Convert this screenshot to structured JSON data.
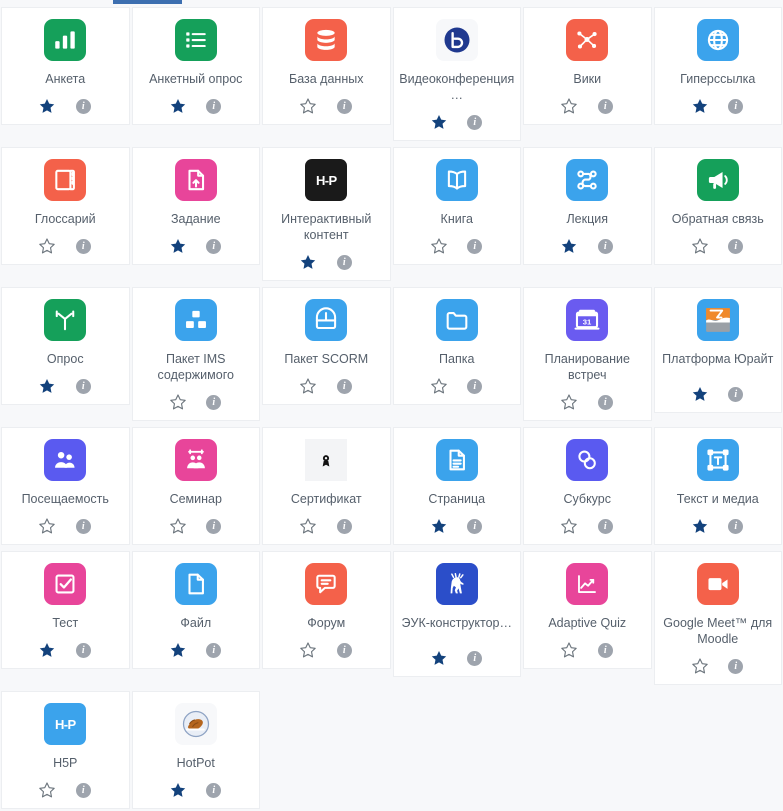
{
  "tab": {
    "active_label": "",
    "accent_color": "#3d6fb0"
  },
  "colors": {
    "star_filled": "#13427c",
    "star_outline": "#6c757d",
    "info_bg": "#9ea4ad",
    "card_bg": "#ffffff",
    "page_bg": "#f7f8fa",
    "label_text": "#555f6b"
  },
  "cards": [
    {
      "label": "Анкета",
      "icon": "bar-chart-icon",
      "icon_bg": "#15a05a",
      "icon_fg": "#ffffff",
      "starred": true,
      "star_icon": "star-filled-icon",
      "info_icon": "info-icon",
      "lines": 1
    },
    {
      "label": "Анкетный опрос",
      "icon": "survey-list-icon",
      "icon_bg": "#15a05a",
      "icon_fg": "#ffffff",
      "starred": true,
      "star_icon": "star-filled-icon",
      "info_icon": "info-icon",
      "lines": 1
    },
    {
      "label": "База данных",
      "icon": "database-icon",
      "icon_bg": "#f4614a",
      "icon_fg": "#ffffff",
      "starred": false,
      "star_icon": "star-outline-icon",
      "info_icon": "info-icon",
      "lines": 1
    },
    {
      "label": "Видеоконференция…",
      "icon": "bigbluebutton-icon",
      "icon_bg": "#f7f8fa",
      "icon_fg": "#20398f",
      "starred": true,
      "star_icon": "star-filled-icon",
      "info_icon": "info-icon",
      "lines": 2
    },
    {
      "label": "Вики",
      "icon": "wiki-network-icon",
      "icon_bg": "#f4614a",
      "icon_fg": "#ffffff",
      "starred": false,
      "star_icon": "star-outline-icon",
      "info_icon": "info-icon",
      "lines": 1
    },
    {
      "label": "Гиперссылка",
      "icon": "globe-link-icon",
      "icon_bg": "#3ba3ec",
      "icon_fg": "#ffffff",
      "starred": true,
      "star_icon": "star-filled-icon",
      "info_icon": "info-icon",
      "lines": 1
    },
    {
      "label": "Глоссарий",
      "icon": "book-glossary-icon",
      "icon_bg": "#f4614a",
      "icon_fg": "#ffffff",
      "starred": false,
      "star_icon": "star-outline-icon",
      "info_icon": "info-icon",
      "lines": 1
    },
    {
      "label": "Задание",
      "icon": "assignment-upload-icon",
      "icon_bg": "#e8459a",
      "icon_fg": "#ffffff",
      "starred": true,
      "star_icon": "star-filled-icon",
      "info_icon": "info-icon",
      "lines": 1
    },
    {
      "label": "Интерактивный контент",
      "icon": "h5p-black-icon",
      "icon_bg": "#1a1a1a",
      "icon_fg": "#ffffff",
      "starred": true,
      "star_icon": "star-filled-icon",
      "info_icon": "info-icon",
      "lines": 2
    },
    {
      "label": "Книга",
      "icon": "book-open-icon",
      "icon_bg": "#3ba3ec",
      "icon_fg": "#ffffff",
      "starred": false,
      "star_icon": "star-outline-icon",
      "info_icon": "info-icon",
      "lines": 1
    },
    {
      "label": "Лекция",
      "icon": "lesson-flow-icon",
      "icon_bg": "#3ba3ec",
      "icon_fg": "#ffffff",
      "starred": true,
      "star_icon": "star-filled-icon",
      "info_icon": "info-icon",
      "lines": 1
    },
    {
      "label": "Обратная связь",
      "icon": "megaphone-icon",
      "icon_bg": "#15a05a",
      "icon_fg": "#ffffff",
      "starred": false,
      "star_icon": "star-outline-icon",
      "info_icon": "info-icon",
      "lines": 1
    },
    {
      "label": "Опрос",
      "icon": "choice-fork-icon",
      "icon_bg": "#15a05a",
      "icon_fg": "#ffffff",
      "starred": true,
      "star_icon": "star-filled-icon",
      "info_icon": "info-icon",
      "lines": 1
    },
    {
      "label": "Пакет IMS содержимого",
      "icon": "ims-package-icon",
      "icon_bg": "#3ba3ec",
      "icon_fg": "#ffffff",
      "starred": false,
      "star_icon": "star-outline-icon",
      "info_icon": "info-icon",
      "lines": 2
    },
    {
      "label": "Пакет SCORM",
      "icon": "scorm-box-icon",
      "icon_bg": "#3ba3ec",
      "icon_fg": "#ffffff",
      "starred": false,
      "star_icon": "star-outline-icon",
      "info_icon": "info-icon",
      "lines": 1
    },
    {
      "label": "Папка",
      "icon": "folder-icon",
      "icon_bg": "#3ba3ec",
      "icon_fg": "#ffffff",
      "starred": false,
      "star_icon": "star-outline-icon",
      "info_icon": "info-icon",
      "lines": 1
    },
    {
      "label": "Планирование встреч",
      "icon": "calendar-31-icon",
      "icon_bg": "#6a5bf0",
      "icon_fg": "#ffffff",
      "starred": false,
      "star_icon": "star-outline-icon",
      "info_icon": "info-icon",
      "lines": 2
    },
    {
      "label": "Платформа Юрайт",
      "icon": "urait-icon",
      "icon_bg": "#3ba3ec",
      "icon_fg": "#f0892a",
      "starred": true,
      "star_icon": "star-filled-icon",
      "info_icon": "info-icon",
      "lines": 2
    },
    {
      "label": "Посещаемость",
      "icon": "attendance-people-icon",
      "icon_bg": "#5a5af0",
      "icon_fg": "#ffffff",
      "starred": false,
      "star_icon": "star-outline-icon",
      "info_icon": "info-icon",
      "lines": 1
    },
    {
      "label": "Семинар",
      "icon": "workshop-icon",
      "icon_bg": "#e8459a",
      "icon_fg": "#ffffff",
      "starred": false,
      "star_icon": "star-outline-icon",
      "info_icon": "info-icon",
      "lines": 1
    },
    {
      "label": "Сертификат",
      "icon": "certificate-icon",
      "icon_bg": "#f3f4f6",
      "icon_fg": "#111111",
      "starred": false,
      "star_icon": "star-outline-icon",
      "info_icon": "info-icon",
      "lines": 1
    },
    {
      "label": "Страница",
      "icon": "page-document-icon",
      "icon_bg": "#3ba3ec",
      "icon_fg": "#ffffff",
      "starred": true,
      "star_icon": "star-filled-icon",
      "info_icon": "info-icon",
      "lines": 1
    },
    {
      "label": "Субкурс",
      "icon": "subcourse-icon",
      "icon_bg": "#5a5af0",
      "icon_fg": "#ffffff",
      "starred": false,
      "star_icon": "star-outline-icon",
      "info_icon": "info-icon",
      "lines": 1
    },
    {
      "label": "Текст и медиа",
      "icon": "text-media-icon",
      "icon_bg": "#3ba3ec",
      "icon_fg": "#ffffff",
      "starred": true,
      "star_icon": "star-filled-icon",
      "info_icon": "info-icon",
      "lines": 1
    },
    {
      "label": "Тест",
      "icon": "quiz-checkbox-icon",
      "icon_bg": "#e8459a",
      "icon_fg": "#ffffff",
      "starred": true,
      "star_icon": "star-filled-icon",
      "info_icon": "info-icon",
      "lines": 1
    },
    {
      "label": "Файл",
      "icon": "file-icon",
      "icon_bg": "#3ba3ec",
      "icon_fg": "#ffffff",
      "starred": true,
      "star_icon": "star-filled-icon",
      "info_icon": "info-icon",
      "lines": 1
    },
    {
      "label": "Форум",
      "icon": "forum-chat-icon",
      "icon_bg": "#f4614a",
      "icon_fg": "#ffffff",
      "starred": false,
      "star_icon": "star-outline-icon",
      "info_icon": "info-icon",
      "lines": 1
    },
    {
      "label": "ЭУК-конструктор…",
      "icon": "euk-deer-icon",
      "icon_bg": "#2b4ec9",
      "icon_fg": "#ffffff",
      "starred": true,
      "star_icon": "star-filled-icon",
      "info_icon": "info-icon",
      "lines": 2
    },
    {
      "label": "Adaptive Quiz",
      "icon": "adaptive-quiz-chart-icon",
      "icon_bg": "#e8459a",
      "icon_fg": "#ffffff",
      "starred": false,
      "star_icon": "star-outline-icon",
      "info_icon": "info-icon",
      "lines": 1
    },
    {
      "label": "Google Meet™ для Moodle",
      "icon": "video-camera-icon",
      "icon_bg": "#f4614a",
      "icon_fg": "#ffffff",
      "starred": false,
      "star_icon": "star-outline-icon",
      "info_icon": "info-icon",
      "lines": 2
    },
    {
      "label": "H5P",
      "icon": "h5p-blue-icon",
      "icon_bg": "#3ba3ec",
      "icon_fg": "#ffffff",
      "starred": false,
      "star_icon": "star-outline-icon",
      "info_icon": "info-icon",
      "lines": 1
    },
    {
      "label": "HotPot",
      "icon": "hotpot-icon",
      "icon_bg": "#f7f8fa",
      "icon_fg": "#b5651d",
      "starred": true,
      "star_icon": "star-filled-icon",
      "info_icon": "info-icon",
      "lines": 1
    }
  ]
}
